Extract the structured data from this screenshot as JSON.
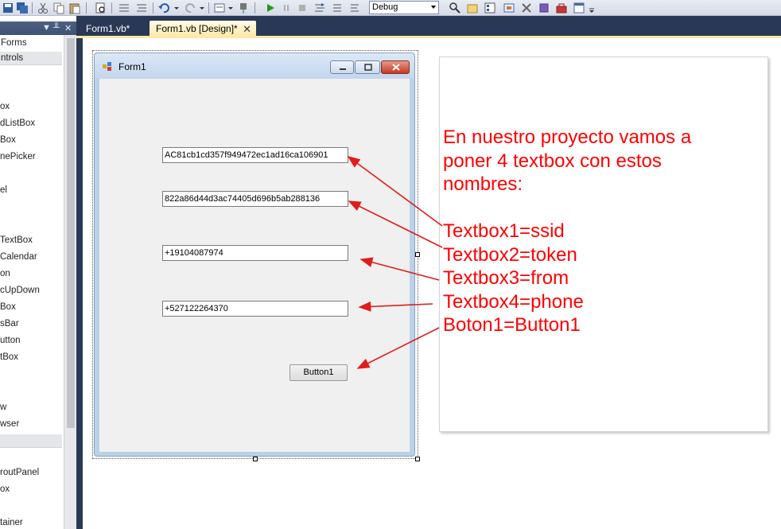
{
  "toolbar": {
    "configuration": "Debug"
  },
  "toolbox": {
    "groups": [
      "Forms",
      "ntrols"
    ],
    "items": [
      "ox",
      "dListBox",
      "Box",
      "nePicker",
      "el",
      "TextBox",
      "Calendar",
      "on",
      "cUpDown",
      "Box",
      "sBar",
      "utton",
      "tBox",
      "w",
      "wser",
      "routPanel",
      "ox",
      "tainer"
    ]
  },
  "tabs": {
    "code_tab": "Form1.vb*",
    "design_tab": "Form1.vb [Design]*",
    "close_glyph": "✕"
  },
  "form": {
    "title": "Form1",
    "textbox1": "AC81cb1cd357f949472ec1ad16ca106901",
    "textbox2": "822a86d44d3ac74405d696b5ab288136",
    "textbox3": "+19104087974",
    "textbox4": "+527122264370",
    "button1": "Button1"
  },
  "note": {
    "text": "En nuestro proyecto vamos a\nponer 4 textbox con estos\nnombres:\n\nTextbox1=ssid\nTextbox2=token\nTextbox3=from\nTextbox4=phone\nBoton1=Button1"
  },
  "colors": {
    "annotation": "#ff0000",
    "ide_background": "#293955",
    "active_tab": "#ffe8a6",
    "form_border": "#b9d1ea"
  }
}
